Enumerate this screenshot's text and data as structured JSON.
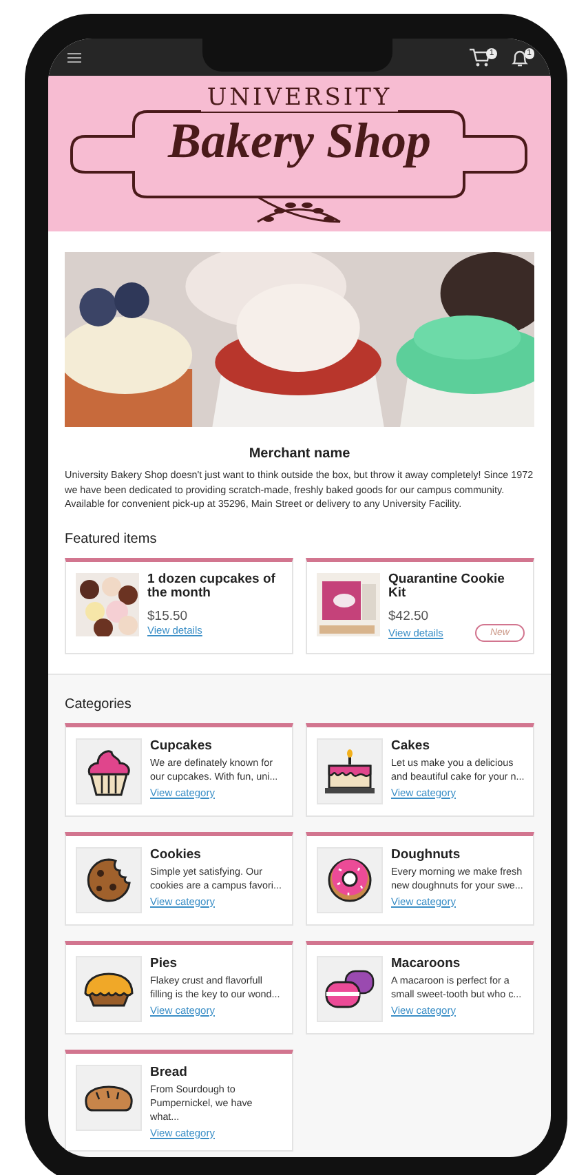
{
  "status_bar": {
    "cart_count": "1",
    "notification_count": "1"
  },
  "logo": {
    "top": "UNIVERSITY",
    "main": "Bakery Shop"
  },
  "merchant": {
    "name": "Merchant name",
    "description": "University Bakery Shop doesn't just want to think outside the box, but throw it away completely! Since 1972 we have been dedicated to providing scratch-made, freshly baked goods for our campus community. Available for convenient pick-up at 35296, Main Street or delivery to any University Facility."
  },
  "featured": {
    "heading": "Featured items",
    "items": [
      {
        "title": "1 dozen cupcakes of the month",
        "price": "$15.50",
        "link": "View details"
      },
      {
        "title": "Quarantine Cookie Kit",
        "price": "$42.50",
        "link": "View details",
        "badge": "New"
      }
    ]
  },
  "categories": {
    "heading": "Categories",
    "items": [
      {
        "kind": "cupcake",
        "name": "Cupcakes",
        "description": "We are definately known for our cupcakes.  With fun, uni...",
        "link": "View category"
      },
      {
        "kind": "cake",
        "name": "Cakes",
        "description": "Let us make you a delicious and beautiful cake for your n...",
        "link": "View category"
      },
      {
        "kind": "cookie",
        "name": "Cookies",
        "description": "Simple yet satisfying. Our cookies are a campus favori...",
        "link": "View category"
      },
      {
        "kind": "doughnut",
        "name": "Doughnuts",
        "description": "Every morning we make fresh new doughnuts for your swe...",
        "link": "View category"
      },
      {
        "kind": "pie",
        "name": "Pies",
        "description": "Flakey crust and flavorfull filling is the key to our wond...",
        "link": "View category"
      },
      {
        "kind": "macaroon",
        "name": "Macaroons",
        "description": "A macaroon is perfect for a small sweet-tooth but who c...",
        "link": "View category"
      },
      {
        "kind": "bread",
        "name": "Bread",
        "description": "From Sourdough to Pumpernickel, we have what...",
        "link": "View category"
      }
    ]
  }
}
